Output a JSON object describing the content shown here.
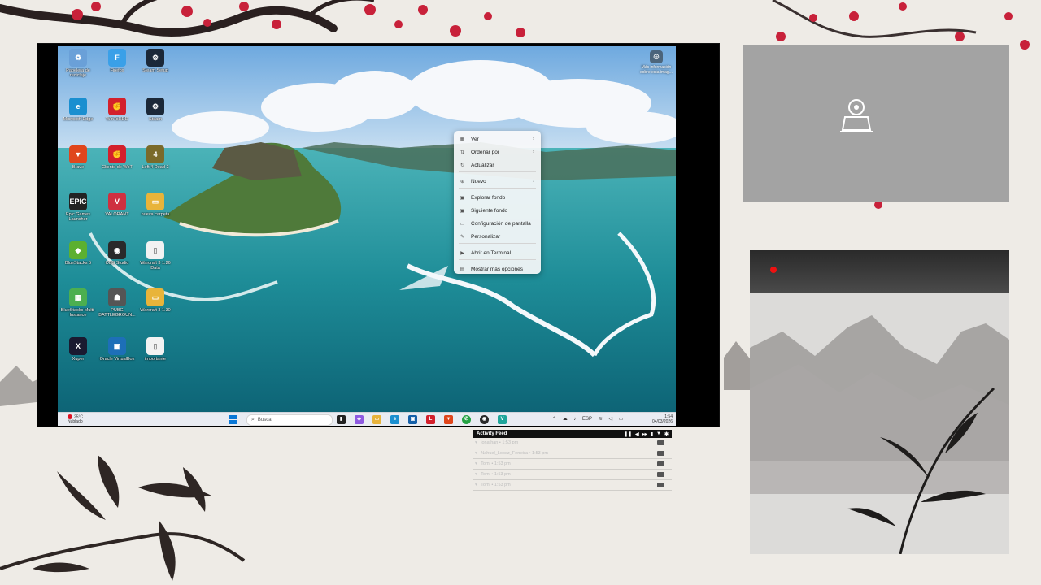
{
  "desktop": {
    "icons": [
      {
        "label": "Papelera de reciclaje",
        "icon": "recycle-bin-icon",
        "color": "#6aa0d8",
        "glyph": "♻"
      },
      {
        "label": "Firefox",
        "icon": "file-icon",
        "color": "#3aa0e8",
        "glyph": "F"
      },
      {
        "label": "Steam Setup",
        "icon": "steam-icon",
        "color": "#1b2838",
        "glyph": "⚙"
      },
      {
        "label": "Microsoft Edge",
        "icon": "edge-icon",
        "color": "#1a8fd0",
        "glyph": "e"
      },
      {
        "label": "WinToHDD",
        "icon": "app-icon",
        "color": "#d3202c",
        "glyph": "✊"
      },
      {
        "label": "Steam",
        "icon": "steam-icon",
        "color": "#1b2838",
        "glyph": "⚙"
      },
      {
        "label": "Brave",
        "icon": "brave-icon",
        "color": "#e0461c",
        "glyph": "▼"
      },
      {
        "label": "Cliente de WoT",
        "icon": "app-icon",
        "color": "#d3202c",
        "glyph": "✊"
      },
      {
        "label": "Left 4 Dead 2",
        "icon": "game-icon",
        "color": "#7a6a2a",
        "glyph": "4"
      },
      {
        "label": "Epic Games Launcher",
        "icon": "epic-icon",
        "color": "#222222",
        "glyph": "EPIC"
      },
      {
        "label": "VALORANT",
        "icon": "valorant-icon",
        "color": "#cf3040",
        "glyph": "V"
      },
      {
        "label": "nueva carpeta",
        "icon": "folder-icon",
        "color": "#e8b43a",
        "glyph": "▭"
      },
      {
        "label": "BlueStacks 5",
        "icon": "bluestacks-icon",
        "color": "#5cb030",
        "glyph": "◆"
      },
      {
        "label": "OBS Studio",
        "icon": "obs-icon",
        "color": "#2a2a2a",
        "glyph": "◉"
      },
      {
        "label": "Warcraft 3 1.26 Data",
        "icon": "document-icon",
        "color": "#f2f2f2",
        "glyph": "▯"
      },
      {
        "label": "BlueStacks Multi-Instance",
        "icon": "bluestacks-icon",
        "color": "#4caf50",
        "glyph": "▦"
      },
      {
        "label": "PUBG BATTLEGROUN...",
        "icon": "pubg-icon",
        "color": "#555555",
        "glyph": "☗"
      },
      {
        "label": "Warcraft 3 1.30",
        "icon": "folder-icon",
        "color": "#e8b43a",
        "glyph": "▭"
      },
      {
        "label": "Xuper",
        "icon": "xuper-icon",
        "color": "#1a1a30",
        "glyph": "X"
      },
      {
        "label": "Oracle VirtualBox",
        "icon": "virtualbox-icon",
        "color": "#1d6fb8",
        "glyph": "▣"
      },
      {
        "label": "importante",
        "icon": "document-icon",
        "color": "#f2f2f2",
        "glyph": "▯"
      }
    ],
    "info_label": "Más información sobre esta imag..."
  },
  "context_menu": {
    "items": [
      {
        "label": "Ver",
        "icon": "grid-icon",
        "submenu": true
      },
      {
        "label": "Ordenar por",
        "icon": "sort-icon",
        "submenu": true
      },
      {
        "label": "Actualizar",
        "icon": "refresh-icon",
        "submenu": false
      },
      {
        "label": "Nuevo",
        "icon": "plus-icon",
        "submenu": true
      },
      {
        "label": "Explorar fondo",
        "icon": "image-icon",
        "submenu": false
      },
      {
        "label": "Siguiente fondo",
        "icon": "image-icon",
        "submenu": false
      },
      {
        "label": "Configuración de pantalla",
        "icon": "display-icon",
        "submenu": false
      },
      {
        "label": "Personalizar",
        "icon": "brush-icon",
        "submenu": false
      },
      {
        "label": "Abrir en Terminal",
        "icon": "terminal-icon",
        "submenu": false
      },
      {
        "label": "Mostrar más opciones",
        "icon": "more-icon",
        "submenu": false
      }
    ]
  },
  "taskbar": {
    "weather_temp": "25°C",
    "weather_desc": "Nublado",
    "search_placeholder": "Buscar",
    "language": "ESP",
    "time": "1:54",
    "date": "04/03/2026"
  },
  "activity_feed": {
    "title": "Activity Feed",
    "rows": [
      {
        "text": "jonathan • 1:53 pm"
      },
      {
        "text": "Nahuel_Lopez_Ferreira • 1:53 pm"
      },
      {
        "text": "Tomi • 1:53 pm"
      },
      {
        "text": "Tomi • 1:53 pm"
      },
      {
        "text": "Tomi • 1:53 pm"
      }
    ]
  },
  "colors": {
    "accent_red": "#c8213a",
    "camera_panel": "#a3a3a3",
    "feed_header": "#111111"
  }
}
